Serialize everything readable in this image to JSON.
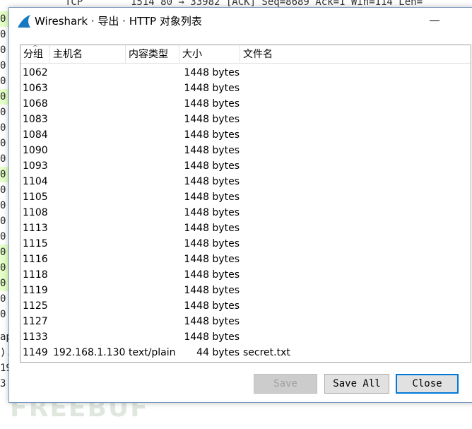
{
  "background": {
    "top_line": [
      {
        "text": "TCP"
      },
      {
        "text": "1514 80 → 33982 [ACK] Seq=8689 Ack=1 Win=114 Len="
      }
    ],
    "left_rows": [
      "0",
      "0",
      "0",
      "0",
      "0",
      "0",
      "0",
      "0",
      "0",
      "0",
      "0",
      "0",
      "0",
      "0",
      "0",
      "0",
      "0",
      "0",
      "0",
      "0"
    ],
    "left_bottom": [
      "ap",
      ").",
      "19",
      "3"
    ],
    "watermark": "FREEBUF"
  },
  "dialog": {
    "title": "Wireshark · 导出 · HTTP 对象列表",
    "columns": [
      "分组",
      "主机名",
      "内容类型",
      "大小",
      "文件名"
    ],
    "rows": [
      {
        "num": "1062",
        "host": "",
        "type": "",
        "size": "1448 bytes",
        "file": ""
      },
      {
        "num": "1063",
        "host": "",
        "type": "",
        "size": "1448 bytes",
        "file": ""
      },
      {
        "num": "1068",
        "host": "",
        "type": "",
        "size": "1448 bytes",
        "file": ""
      },
      {
        "num": "1083",
        "host": "",
        "type": "",
        "size": "1448 bytes",
        "file": ""
      },
      {
        "num": "1084",
        "host": "",
        "type": "",
        "size": "1448 bytes",
        "file": ""
      },
      {
        "num": "1090",
        "host": "",
        "type": "",
        "size": "1448 bytes",
        "file": ""
      },
      {
        "num": "1093",
        "host": "",
        "type": "",
        "size": "1448 bytes",
        "file": ""
      },
      {
        "num": "1104",
        "host": "",
        "type": "",
        "size": "1448 bytes",
        "file": ""
      },
      {
        "num": "1105",
        "host": "",
        "type": "",
        "size": "1448 bytes",
        "file": ""
      },
      {
        "num": "1108",
        "host": "",
        "type": "",
        "size": "1448 bytes",
        "file": ""
      },
      {
        "num": "1113",
        "host": "",
        "type": "",
        "size": "1448 bytes",
        "file": ""
      },
      {
        "num": "1115",
        "host": "",
        "type": "",
        "size": "1448 bytes",
        "file": ""
      },
      {
        "num": "1116",
        "host": "",
        "type": "",
        "size": "1448 bytes",
        "file": ""
      },
      {
        "num": "1118",
        "host": "",
        "type": "",
        "size": "1448 bytes",
        "file": ""
      },
      {
        "num": "1119",
        "host": "",
        "type": "",
        "size": "1448 bytes",
        "file": ""
      },
      {
        "num": "1125",
        "host": "",
        "type": "",
        "size": "1448 bytes",
        "file": ""
      },
      {
        "num": "1127",
        "host": "",
        "type": "",
        "size": "1448 bytes",
        "file": ""
      },
      {
        "num": "1133",
        "host": "",
        "type": "",
        "size": "1448 bytes",
        "file": ""
      },
      {
        "num": "1149",
        "host": "192.168.1.130",
        "type": "text/plain",
        "size": "44 bytes",
        "file": "secret.txt"
      }
    ],
    "buttons": {
      "save": "Save",
      "save_all": "Save All",
      "close": "Close"
    },
    "icons": {
      "app": "wireshark-fin-icon",
      "sort": "sort-ascending-icon"
    },
    "colors": {
      "accent": "#0078d7",
      "wireshark_blue": "#1679c2",
      "green_row": "#e4ffc7"
    }
  }
}
